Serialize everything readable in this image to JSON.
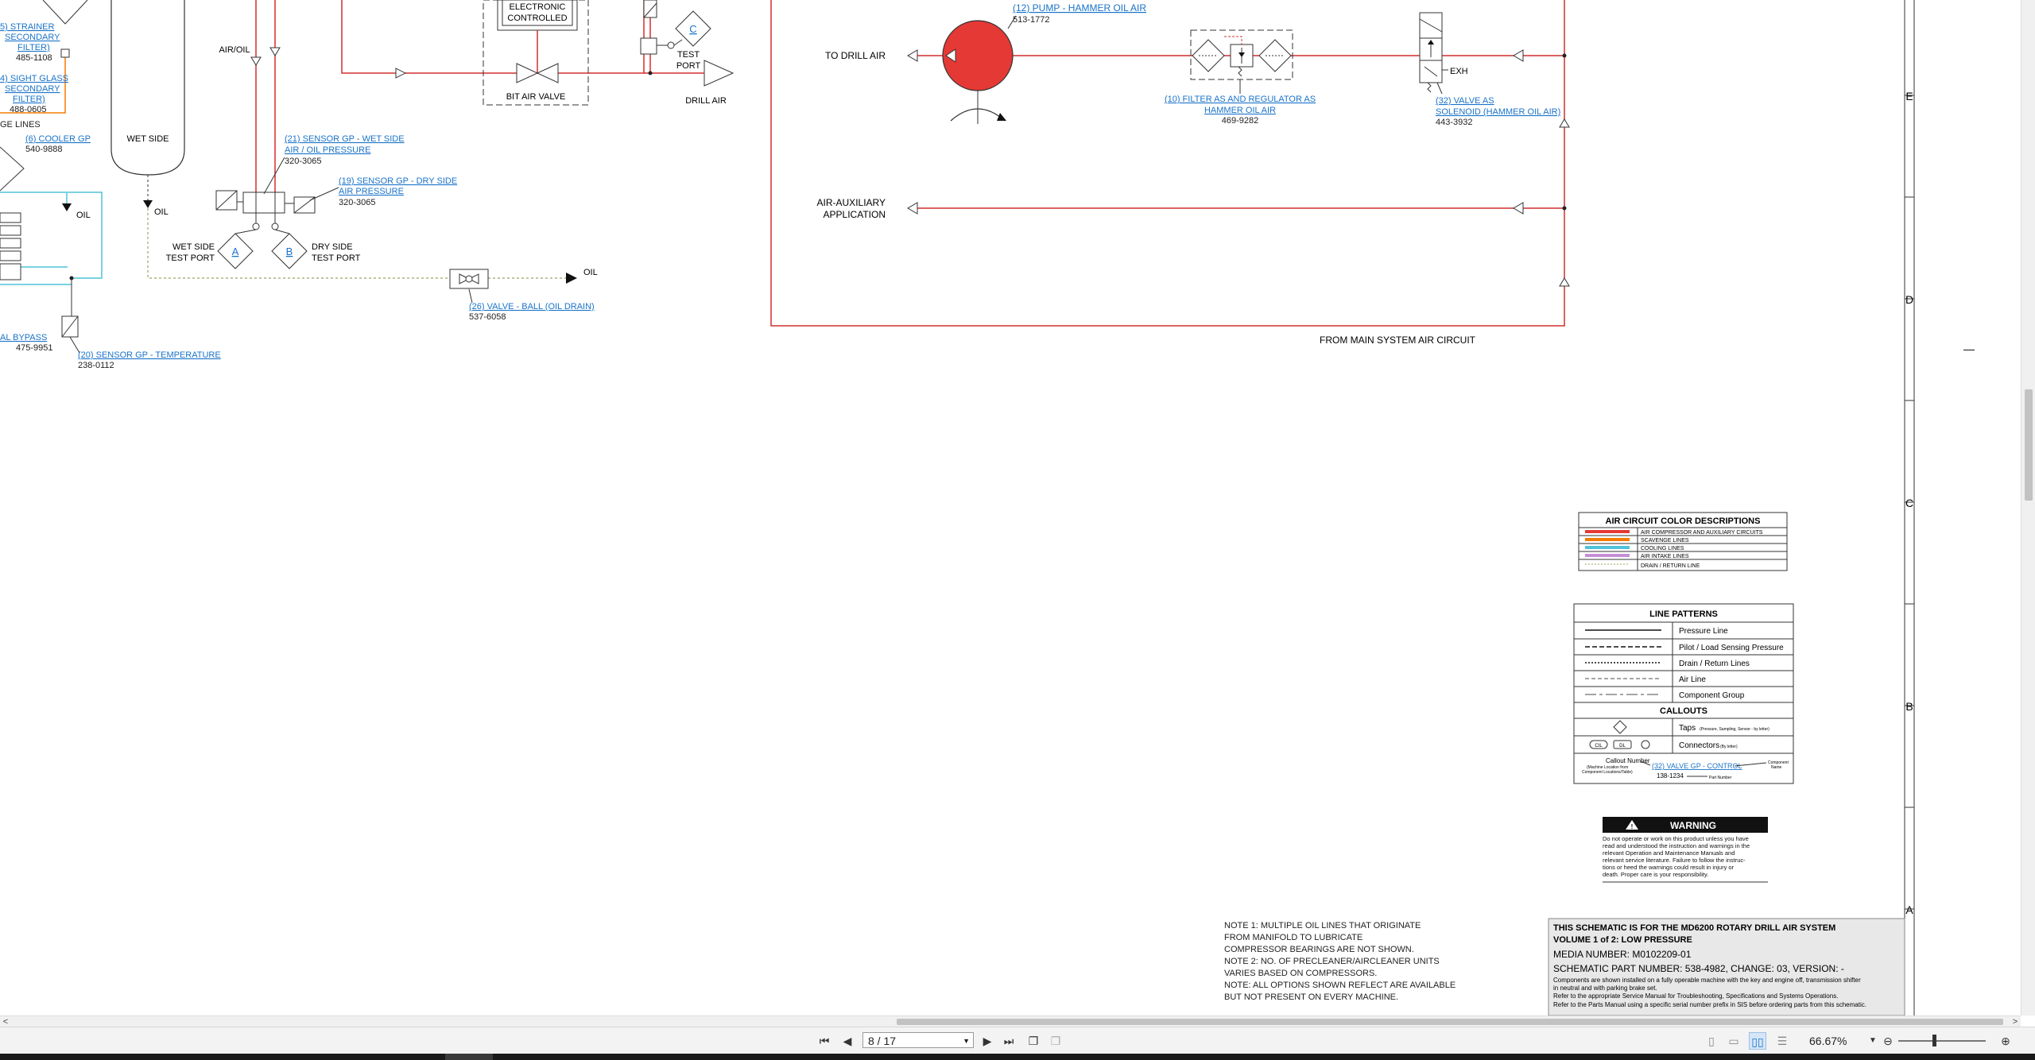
{
  "schematic": {
    "labels": {
      "air_oil": "AIR/OIL",
      "wet_side": "WET SIDE",
      "oil": "OIL",
      "ge_lines": "GE LINES",
      "wet_side_test_port_1": "WET SIDE",
      "wet_side_test_port_2": "TEST PORT",
      "dry_side_test_port_1": "DRY SIDE",
      "dry_side_test_port_2": "TEST PORT",
      "tap_a": "A",
      "tap_b": "B",
      "tap_c": "C",
      "electronic_1": "ELECTRONIC",
      "electronic_2": "CONTROLLED",
      "bit_air_valve": "BIT AIR VALVE",
      "test_port_1": "TEST",
      "test_port_2": "PORT",
      "drill_air": "DRILL AIR",
      "to_drill_air": "TO DRILL AIR",
      "air_aux_1": "AIR-AUXILIARY",
      "air_aux_2": "APPLICATION",
      "exh": "EXH",
      "from_main": "FROM MAIN SYSTEM AIR CIRCUIT",
      "oil_drain": "OIL"
    },
    "callouts": [
      {
        "link": "5) STRAINER",
        "link2": "SECONDARY",
        "link3": "FILTER)",
        "part": "485-1108"
      },
      {
        "link": "4) SIGHT GLASS",
        "link2": "SECONDARY",
        "link3": "FILTER)",
        "part": "488-0605"
      },
      {
        "link": "(6) COOLER GP",
        "part": "540-9888"
      },
      {
        "link": "(21) SENSOR GP - WET SIDE",
        "link2": "AIR / OIL PRESSURE",
        "part": "320-3065"
      },
      {
        "link": "(19) SENSOR GP - DRY SIDE",
        "link2": "AIR PRESSURE",
        "part": "320-3065"
      },
      {
        "link": "(26) VALVE - BALL (OIL DRAIN)",
        "part": "537-6058"
      },
      {
        "link": "AL BYPASS",
        "part": "475-9951"
      },
      {
        "link": "(20) SENSOR GP - TEMPERATURE",
        "part": "238-0112"
      },
      {
        "link": "(12) PUMP - HAMMER OIL AIR",
        "part": "513-1772"
      },
      {
        "link": "(10) FILTER AS AND REGULATOR AS",
        "link2": "HAMMER OIL AIR",
        "part": "469-9282"
      },
      {
        "link": "(32) VALVE AS",
        "link2": "SOLENOID (HAMMER OIL AIR)",
        "part": "443-3932"
      }
    ],
    "grid_letters": [
      "E",
      "D",
      "C",
      "B",
      "A"
    ],
    "color_table": {
      "title": "AIR CIRCUIT COLOR DESCRIPTIONS",
      "rows": [
        {
          "color": "#e53935",
          "label": "AIR COMPRESSOR AND AUXILIARY CIRCUITS"
        },
        {
          "color": "#f57c00",
          "label": "SCAVENGE LINES"
        },
        {
          "color": "#4fc3d9",
          "label": "COOLING LINES"
        },
        {
          "color": "#c58fd6",
          "label": "AIR INTAKE LINES"
        },
        {
          "color": "#a0a060",
          "label": "DRAIN / RETURN LINE"
        }
      ]
    },
    "line_patterns": {
      "title": "LINE PATTERNS",
      "rows": [
        "Pressure Line",
        "Pilot / Load Sensing Pressure",
        "Drain / Return Lines",
        "Air Line",
        "Component Group"
      ],
      "callouts_title": "CALLOUTS",
      "taps": "Taps",
      "taps_note": "(Pressure, Sampling, Sensor - by letter)",
      "connectors": "Connectors",
      "connectors_note": "(By letter)",
      "conn_1": "CIL",
      "conn_2": "DL",
      "example_callout_1": "Callout Number",
      "example_callout_2": "(Machine Location from",
      "example_callout_3": "Component Locations/Table)",
      "example_link": "(32) VALVE GP - CONTROL",
      "example_part": "138-1234",
      "part_number": "Part Number",
      "component_1": "Component",
      "component_2": "Name"
    },
    "warning": {
      "title": "WARNING",
      "lines": [
        "Do not operate or work on this product unless you have",
        "read and understood the instruction and warnings in the",
        "relevant Operation and Maintenance Manuals and",
        "relevant service literature. Failure to follow the instruc-",
        "tions or heed the warnings could result in injury or",
        "death. Proper care is your responsibility."
      ]
    },
    "notes": [
      "NOTE 1: MULTIPLE OIL LINES THAT ORIGINATE",
      "FROM MANIFOLD TO LUBRICATE",
      "COMPRESSOR BEARINGS ARE NOT SHOWN.",
      "NOTE 2: NO. OF PRECLEANER/AIRCLEANER UNITS",
      "VARIES BASED ON COMPRESSORS.",
      "NOTE: ALL OPTIONS SHOWN REFLECT ARE AVAILABLE",
      "BUT NOT PRESENT ON EVERY MACHINE."
    ],
    "title_block": {
      "line1": "THIS SCHEMATIC IS FOR THE MD6200 ROTARY DRILL AIR SYSTEM",
      "line2": "VOLUME 1 of 2: LOW PRESSURE",
      "media": "MEDIA NUMBER: M0102209-01",
      "part": "SCHEMATIC PART NUMBER: 538-4982, CHANGE: 03, VERSION: -",
      "fine1": "Components are shown installed on a fully operable machine with the key and engine off, transmission shifter",
      "fine2": "in neutral and with parking brake set.",
      "fine3": "Refer to the appropriate Service Manual for Troubleshooting, Specifications and Systems Operations.",
      "fine4": "Refer to the Parts Manual using a specific serial number prefix in SIS before ordering parts from this schematic."
    },
    "colors": {
      "air": "#d32f2f",
      "cooling": "#4fc3d9",
      "scavenge": "#f57c00",
      "link": "#1a73c9",
      "drain": "#a0a060"
    }
  },
  "viewer": {
    "page_field": "8 / 17",
    "zoom": "66.67%",
    "scroll_left_arrow": "<",
    "scroll_right_arrow": ">",
    "dash_mark": "—"
  }
}
